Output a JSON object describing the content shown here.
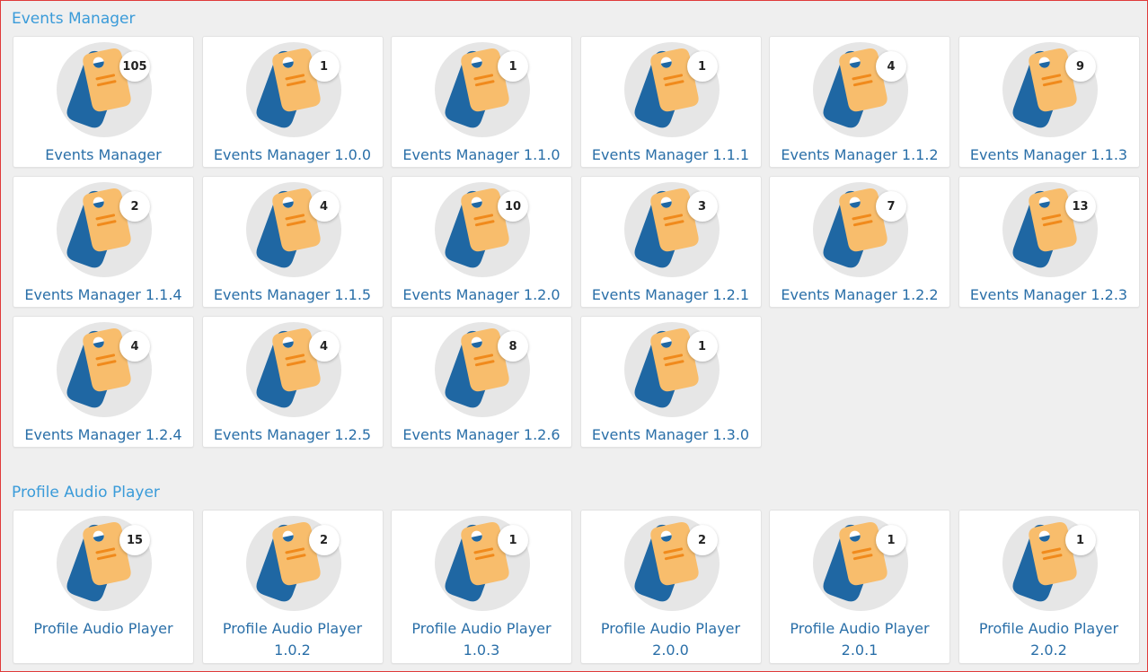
{
  "sections": [
    {
      "title": "Events Manager",
      "items": [
        {
          "label": "Events Manager",
          "count": "105"
        },
        {
          "label": "Events Manager 1.0.0",
          "count": "1"
        },
        {
          "label": "Events Manager 1.1.0",
          "count": "1"
        },
        {
          "label": "Events Manager 1.1.1",
          "count": "1"
        },
        {
          "label": "Events Manager 1.1.2",
          "count": "4"
        },
        {
          "label": "Events Manager 1.1.3",
          "count": "9"
        },
        {
          "label": "Events Manager 1.1.4",
          "count": "2"
        },
        {
          "label": "Events Manager 1.1.5",
          "count": "4"
        },
        {
          "label": "Events Manager 1.2.0",
          "count": "10"
        },
        {
          "label": "Events Manager 1.2.1",
          "count": "3"
        },
        {
          "label": "Events Manager 1.2.2",
          "count": "7"
        },
        {
          "label": "Events Manager 1.2.3",
          "count": "13"
        },
        {
          "label": "Events Manager 1.2.4",
          "count": "4"
        },
        {
          "label": "Events Manager 1.2.5",
          "count": "4"
        },
        {
          "label": "Events Manager 1.2.6",
          "count": "8"
        },
        {
          "label": "Events Manager 1.3.0",
          "count": "1"
        }
      ]
    },
    {
      "title": "Profile Audio Player",
      "items": [
        {
          "label": "Profile Audio Player",
          "count": "15"
        },
        {
          "label": "Profile Audio Player 1.0.2",
          "count": "2"
        },
        {
          "label": "Profile Audio Player 1.0.3",
          "count": "1"
        },
        {
          "label": "Profile Audio Player 2.0.0",
          "count": "2"
        },
        {
          "label": "Profile Audio Player 2.0.1",
          "count": "1"
        },
        {
          "label": "Profile Audio Player 2.0.2",
          "count": "1"
        }
      ]
    }
  ],
  "icon": "tag-icon",
  "colors": {
    "title": "#3a9bd9",
    "label": "#2a6fa8",
    "tag_front": "#f8bd6c",
    "tag_back": "#1f67a3",
    "tag_lines": "#f08a1c",
    "icon_circle": "#e6e6e6"
  }
}
